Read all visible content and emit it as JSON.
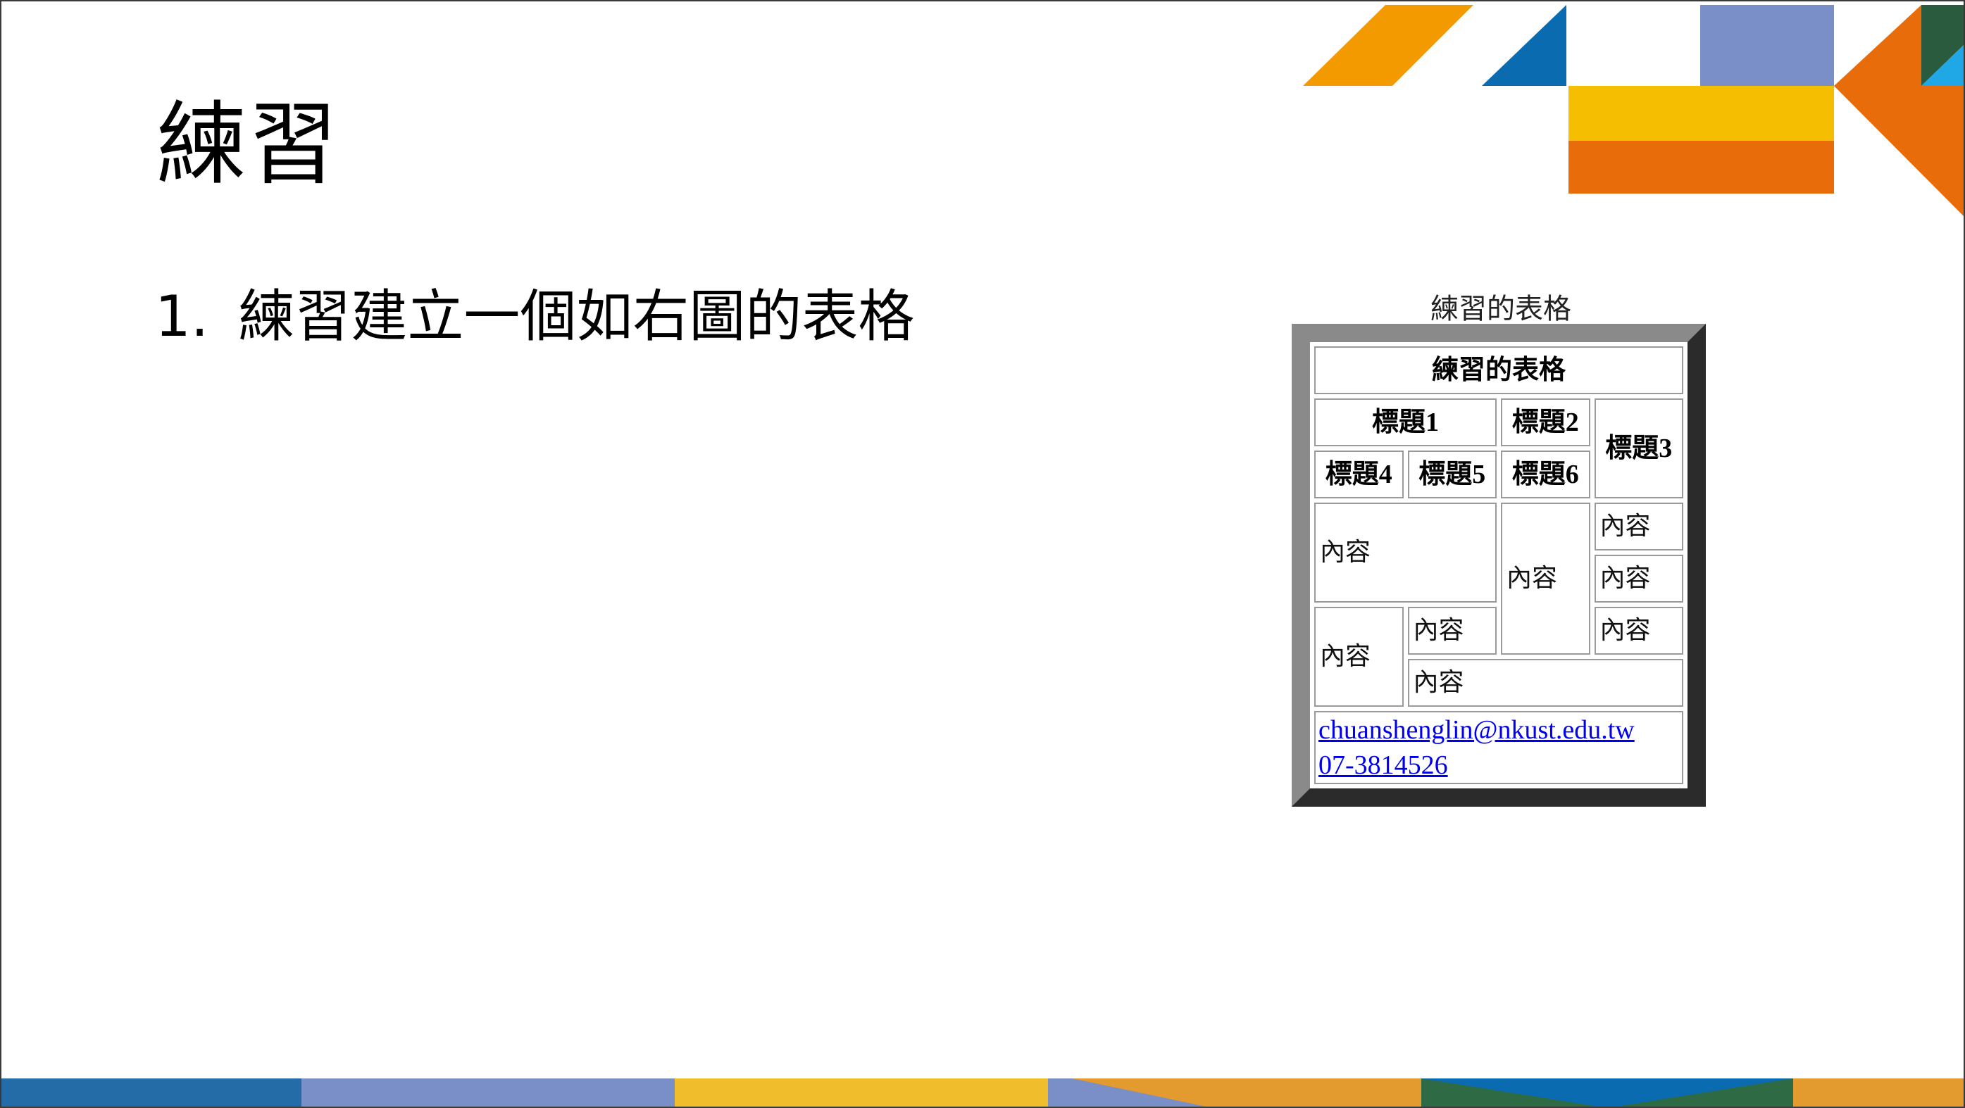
{
  "slide": {
    "title": "練習",
    "bullet_number": "1.",
    "bullet_text": "練習建立一個如右圖的表格"
  },
  "figure": {
    "caption": "練習的表格",
    "table": {
      "header": "練習的表格",
      "headings": [
        "標題1",
        "標題2",
        "標題3",
        "標題4",
        "標題5",
        "標題6"
      ],
      "content_label": "內容",
      "email": "chuanshenglin@nkust.edu.tw",
      "phone": "07-3814526"
    }
  },
  "colors": {
    "orange": "#F39A00",
    "blue": "#0A6BB0",
    "lavender": "#7A8EC8",
    "yellow": "#F5BE00",
    "dark_orange": "#E86D0A",
    "dark_green": "#2A5B3E",
    "cyan": "#1FA7E6",
    "bottom_blue": "#236CA8",
    "bottom_gold": "#F0BD2D",
    "bottom_orange": "#E39A2E",
    "bottom_green": "#2E6B45"
  }
}
